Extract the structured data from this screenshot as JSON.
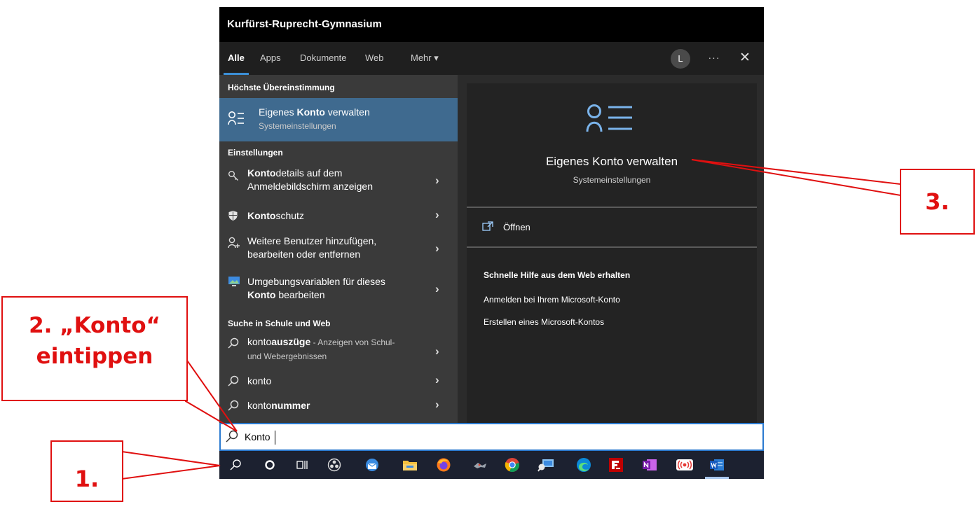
{
  "window": {
    "title": "Kurfürst-Ruprecht-Gymnasium"
  },
  "tabs": [
    {
      "label": "Alle",
      "active": true
    },
    {
      "label": "Apps"
    },
    {
      "label": "Dokumente"
    },
    {
      "label": "Web"
    },
    {
      "label": "Mehr ▾"
    }
  ],
  "header": {
    "avatar": "L",
    "more": "···",
    "close": "✕"
  },
  "best_match": {
    "heading": "Höchste Übereinstimmung",
    "pre": "Eigenes ",
    "bold": "Konto",
    "post": " verwalten",
    "sub": "Systemeinstellungen",
    "icon": "account-list-icon"
  },
  "settings": {
    "heading": "Einstellungen",
    "items": [
      {
        "bold": "Konto",
        "post": "details auf dem",
        "line2": "Anmeldebildschirm anzeigen",
        "icon": "key-icon"
      },
      {
        "bold": "Konto",
        "post": "schutz",
        "icon": "shield-icon"
      },
      {
        "line1": "Weitere Benutzer hinzufügen,",
        "line2": "bearbeiten oder entfernen",
        "icon": "add-user-icon"
      },
      {
        "line1": "Umgebungsvariablen für dieses",
        "bold2": "Konto",
        "post2": " bearbeiten",
        "icon": "monitor-icon"
      }
    ]
  },
  "web": {
    "heading": "Suche in Schule und Web",
    "items": [
      {
        "pre": "konto",
        "bold": "auszüge",
        "rest": " - Anzeigen von Schul-",
        "line2": "und Webergebnissen"
      },
      {
        "pre": "konto"
      },
      {
        "pre": "konto",
        "bold": "nummer"
      }
    ]
  },
  "preview": {
    "title": "Eigenes Konto verwalten",
    "sub": "Systemeinstellungen",
    "open_label": "Öffnen",
    "help_heading": "Schnelle Hilfe aus dem Web erhalten",
    "links": [
      "Anmelden bei Ihrem Microsoft-Konto",
      "Erstellen eines Microsoft-Kontos"
    ]
  },
  "search": {
    "value": "Konto"
  },
  "taskbar": {
    "apps": [
      "search-icon",
      "cortana-icon",
      "task-view-icon",
      "obs-icon",
      "thunderbird-icon",
      "file-explorer-icon",
      "firefox-icon",
      "app-icon",
      "chrome-icon",
      "remote-desktop-icon",
      "edge-icon",
      "filezilla-icon",
      "onenote-icon",
      "radio-icon",
      "word-icon"
    ]
  },
  "annotations": {
    "one": "1.",
    "two_line1": "2. „Konto“",
    "two_line2": "eintippen",
    "three": "3."
  },
  "colors": {
    "accent": "#3b8fd6",
    "highlight": "#3f6a8f",
    "annotation": "#e01010"
  }
}
